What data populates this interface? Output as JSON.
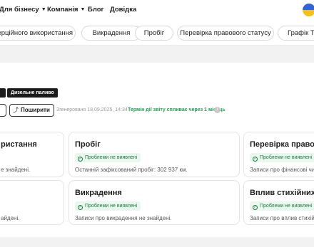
{
  "header": {
    "nav": [
      {
        "label": "Для бізнесу",
        "chevron": true
      },
      {
        "label": "Компанія",
        "chevron": true
      },
      {
        "label": "Блог",
        "chevron": false
      },
      {
        "label": "Довідка",
        "chevron": false
      }
    ],
    "flag": "ukraine-flag-icon"
  },
  "tabs": [
    {
      "label": "мерційного використання"
    },
    {
      "label": "Викрадення"
    },
    {
      "label": "Пробіг"
    },
    {
      "label": "Перевірка правового статусу"
    },
    {
      "label": "Графік ТО"
    }
  ],
  "vehicle": {
    "badges": [
      "",
      "Дизельне паливо"
    ]
  },
  "actions": {
    "share_label": "Поширити",
    "share_icon": "share-icon"
  },
  "meta": {
    "updated": "Згенеровано 18.09.2025, 14:34",
    "deadline": "Термін дії звіту спливає через 1 місяць"
  },
  "cards": [
    {
      "title": "ристання",
      "status": "",
      "text": "е знайдені."
    },
    {
      "title": "Пробіг",
      "status": "Проблеми не виявлені",
      "text": "Останній зафіксований пробіг: 302 937 км."
    },
    {
      "title": "Перевірка правово",
      "status": "Проблеми не виявлені",
      "text": "Записи про фінансові чи с"
    },
    {
      "title": "",
      "status": "",
      "text": "айдені."
    },
    {
      "title": "Викрадення",
      "status": "Проблеми не виявлені",
      "text": "Записи про викрадення не знайдені."
    },
    {
      "title": "Вплив стихійних ли",
      "status": "Проблеми не виявлені",
      "text": "Записи про вплив стихійн"
    }
  ],
  "colors": {
    "accent_green": "#1e9e54",
    "status_bg": "#e9f7ee",
    "badge_bg": "#1a1a1a"
  }
}
